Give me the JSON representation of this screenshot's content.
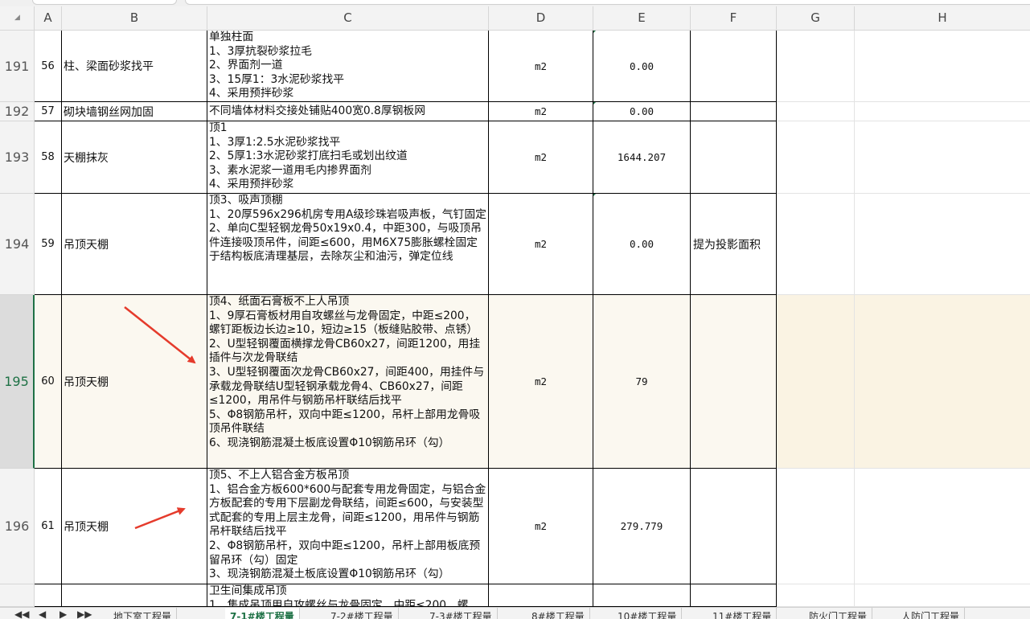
{
  "columns": [
    "A",
    "B",
    "C",
    "D",
    "E",
    "F",
    "G",
    "H"
  ],
  "rows": [
    {
      "num": "191",
      "a": "56",
      "b": "柱、梁面砂浆找平",
      "c": "单独柱面\n1、3厚抗裂砂浆拉毛\n2、界面剂一道\n3、15厚1：3水泥砂浆找平\n4、采用预拌砂浆",
      "d": "m2",
      "e": "0.00",
      "f": ""
    },
    {
      "num": "192",
      "a": "57",
      "b": "砌块墙钢丝网加固",
      "c": "不同墙体材料交接处铺贴400宽0.8厚钢板网",
      "d": "m2",
      "e": "0.00",
      "f": ""
    },
    {
      "num": "193",
      "a": "58",
      "b": "天棚抹灰",
      "c": "顶1\n1、3厚1:2.5水泥砂浆找平\n2、5厚1:3水泥砂浆打底扫毛或划出纹道\n3、素水泥浆一道用毛内掺界面剂\n4、采用预拌砂浆",
      "d": "m2",
      "e": "1644.207",
      "f": ""
    },
    {
      "num": "194",
      "a": "59",
      "b": "吊顶天棚",
      "c": "顶3、吸声顶棚\n1、20厚596x296机房专用A级珍珠岩吸声板，气钉固定\n2、单向C型轻钢龙骨50x19x0.4，中距300，与吸顶吊件连接吸顶吊件，间距≤600，用M6X75膨胀螺栓固定于结构板底清理基层，去除灰尘和油污，弹定位线",
      "d": "m2",
      "e": "0.00",
      "f": "提为投影面积"
    },
    {
      "num": "195",
      "a": "60",
      "b": "吊顶天棚",
      "c": "顶4、纸面石膏板不上人吊顶\n1、9厚石膏板材用自攻螺丝与龙骨固定，中距≤200，螺钉距板边长边≥10，短边≥15（板缝贴胶带、点锈）\n2、U型轻钢覆面横撑龙骨CB60x27，间距1200，用挂插件与次龙骨联结\n3、U型轻钢覆面次龙骨CB60x27，间距400，用挂件与承载龙骨联结U型轻钢承载龙骨4、CB60x27，间距≤1200，用吊件与钢筋吊杆联结后找平\n5、Φ8钢筋吊杆，双向中距≤1200，吊杆上部用龙骨吸顶吊件联结\n6、现浇钢筋混凝土板底设置Φ10钢筋吊环（勾）",
      "d": "m2",
      "e": "79",
      "f": ""
    },
    {
      "num": "196",
      "a": "61",
      "b": "吊顶天棚",
      "c": "顶5、不上人铝合金方板吊顶\n1、铝合金方板600*600与配套专用龙骨固定，与铝合金方板配套的专用下层副龙骨联结，间距≤600，与安装型式配套的专用上层主龙骨，间距≤1200，用吊件与钢筋吊杆联结后找平\n2、Φ8钢筋吊杆，双向中距≤1200，吊杆上部用板底预留吊环（勾）固定\n3、现浇钢筋混凝土板底设置Φ10钢筋吊环（勾）",
      "d": "m2",
      "e": "279.779",
      "f": ""
    },
    {
      "num": "",
      "a": "",
      "b": "",
      "c": "卫生间集成吊顶\n1、集成吊顶用自攻螺丝与龙骨固定，中距≤200，螺",
      "d": "",
      "e": "",
      "f": ""
    }
  ],
  "tabs": [
    "地下室工程量",
    "7-1#楼工程量",
    "7-2#楼工程量",
    "7-3#楼工程量",
    "8#楼工程量",
    "10#楼工程量",
    "11#楼工程量",
    "防火门工程量",
    "人防门工程量"
  ],
  "tab_nav": [
    "◀◀",
    "◀",
    "▶",
    "▶▶"
  ],
  "colors": {
    "accent": "#1e7145",
    "arrow": "#e53b2c",
    "selected_row": "#fbf8f0"
  }
}
